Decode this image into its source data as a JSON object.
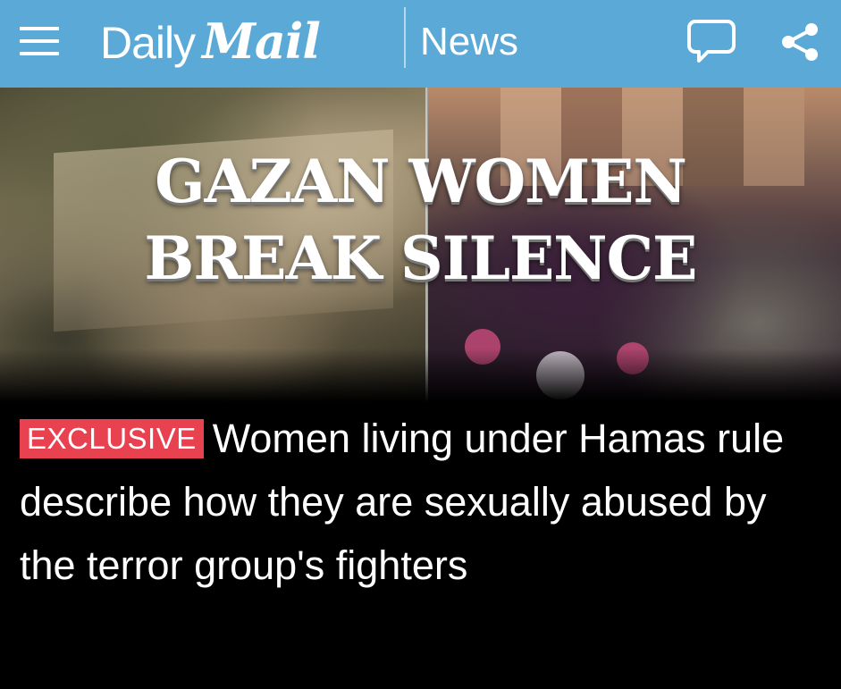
{
  "header": {
    "brand_daily": "Daily",
    "brand_mail": "Mail",
    "section": "News",
    "icons": {
      "menu": "hamburger-menu-icon",
      "comment": "comment-bubble-icon",
      "share": "share-icon"
    },
    "bar_color": "#5aa9d6"
  },
  "hero": {
    "headline_line1": "GAZAN WOMEN",
    "headline_line2": "BREAK SILENCE"
  },
  "article": {
    "badge": "EXCLUSIVE",
    "badge_color": "#e84250",
    "title": "Women living under Hamas rule describe how they are sexually abused by the terror group's fighters"
  }
}
